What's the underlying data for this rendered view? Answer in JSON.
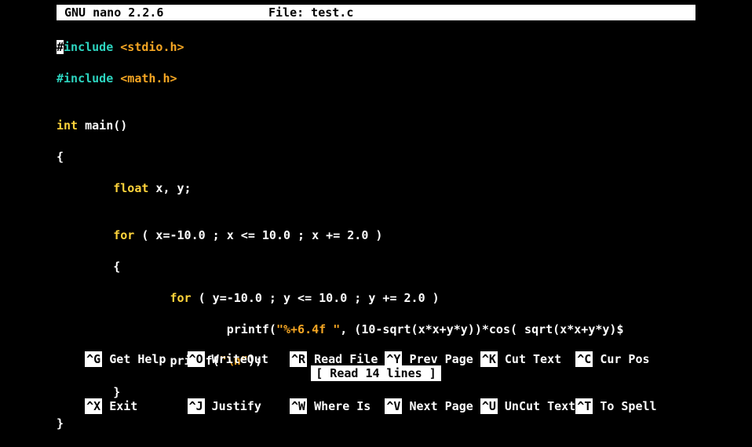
{
  "title": {
    "app": "GNU nano 2.2.6",
    "file_label": "File: test.c"
  },
  "code": {
    "l0_hash": "#",
    "l0_inc": "include ",
    "l0_hdr": "<stdio.h>",
    "l1_hash": "#",
    "l1_inc": "include ",
    "l1_hdr": "<math.h>",
    "blank": "",
    "l3_int": "int",
    "l3_rest": " main()",
    "l4": "{",
    "l5_pad": "        ",
    "l5_float": "float",
    "l5_rest": " x, y;",
    "l7_pad": "        ",
    "l7_for": "for",
    "l7_rest": " ( x=-10.0 ; x <= 10.0 ; x += 2.0 )",
    "l8": "        {",
    "l9_pad": "                ",
    "l9_for": "for",
    "l9_rest": " ( y=-10.0 ; y <= 10.0 ; y += 2.0 )",
    "l10_pad": "                        printf(",
    "l10_str": "\"%+6.4f \"",
    "l10_rest": ", (10-sqrt(x*x+y*y))*cos( sqrt(x*x+y*y)$",
    "l11_pad": "                printf(",
    "l11_str": "\"\\n\"",
    "l11_rest": ");",
    "l12": "        }",
    "l13": "}"
  },
  "status": "[ Read 14 lines ]",
  "shortcuts": {
    "row1": [
      {
        "k": "^G",
        "t": "Get Help "
      },
      {
        "k": "^O",
        "t": "WriteOut "
      },
      {
        "k": "^R",
        "t": "Read File"
      },
      {
        "k": "^Y",
        "t": "Prev Page"
      },
      {
        "k": "^K",
        "t": "Cut Text "
      },
      {
        "k": "^C",
        "t": "Cur Pos"
      }
    ],
    "row2": [
      {
        "k": "^X",
        "t": "Exit     "
      },
      {
        "k": "^J",
        "t": "Justify  "
      },
      {
        "k": "^W",
        "t": "Where Is "
      },
      {
        "k": "^V",
        "t": "Next Page"
      },
      {
        "k": "^U",
        "t": "UnCut Text"
      },
      {
        "k": "^T",
        "t": "To Spell"
      }
    ]
  }
}
